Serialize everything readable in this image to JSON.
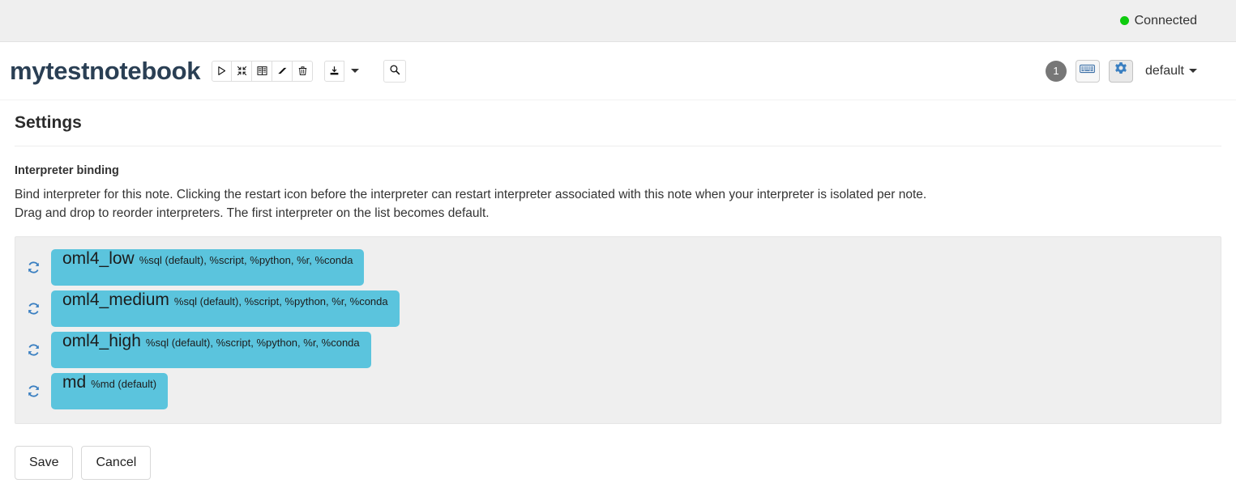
{
  "statusbar": {
    "connection_label": "Connected",
    "connection_color": "#0ecb0e"
  },
  "notebook": {
    "title": "mytestnotebook",
    "toolbar": [
      {
        "name": "run-all-paragraphs",
        "icon": "play-icon",
        "title": "Run all paragraphs"
      },
      {
        "name": "toggle-show-hide-code",
        "icon": "collapse-icon",
        "title": "Show/hide the code"
      },
      {
        "name": "toggle-show-hide-output",
        "icon": "book-icon",
        "title": "Show/hide the output"
      },
      {
        "name": "clear-output",
        "icon": "eraser-icon",
        "title": "Clear output"
      },
      {
        "name": "delete-note",
        "icon": "trash-icon",
        "title": "Remove the notebook"
      },
      {
        "name": "export-note",
        "icon": "export-icon",
        "title": "Export the notebook"
      },
      {
        "name": "search-code",
        "icon": "search-icon",
        "title": "Search code"
      }
    ],
    "revision_count": "1",
    "keyboard_shortcuts_title": "List of shortcuts",
    "settings_title": "Interpreter binding",
    "version_selector": "default"
  },
  "settings": {
    "heading": "Settings",
    "section_label": "Interpreter binding",
    "description_line1": "Bind interpreter for this note. Clicking the restart icon before the interpreter can restart interpreter associated with this note when your interpreter is isolated per note.",
    "description_line2": "Drag and drop to reorder interpreters. The first interpreter on the list becomes default.",
    "chip_color": "#5bc4dd",
    "panel_color": "#efefef",
    "interpreters": [
      {
        "name": "oml4_low",
        "modes": "%sql (default), %script, %python, %r, %conda"
      },
      {
        "name": "oml4_medium",
        "modes": "%sql (default), %script, %python, %r, %conda"
      },
      {
        "name": "oml4_high",
        "modes": "%sql (default), %script, %python, %r, %conda"
      },
      {
        "name": "md",
        "modes": "%md (default)"
      }
    ],
    "save_label": "Save",
    "cancel_label": "Cancel"
  }
}
